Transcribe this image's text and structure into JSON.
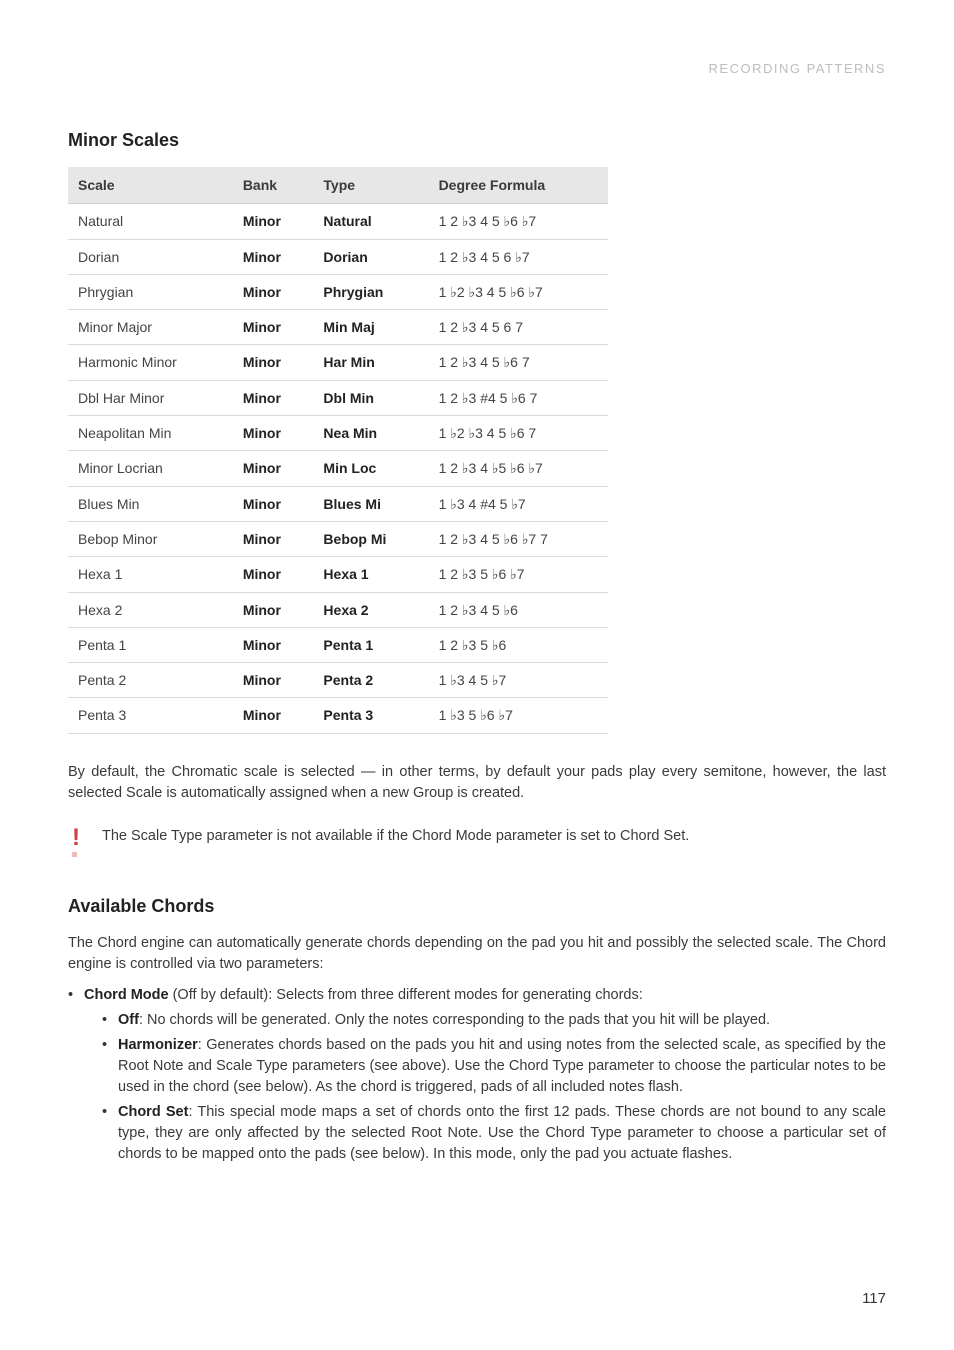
{
  "running_head": "RECORDING PATTERNS",
  "section1_title": "Minor Scales",
  "table_headers": {
    "scale": "Scale",
    "bank": "Bank",
    "type": "Type",
    "formula": "Degree Formula"
  },
  "scales": [
    {
      "name": "Natural",
      "bank": "Minor",
      "type": "Natural",
      "formula": "1 2 ♭3 4 5 ♭6 ♭7"
    },
    {
      "name": "Dorian",
      "bank": "Minor",
      "type": "Dorian",
      "formula": "1 2 ♭3 4 5 6 ♭7"
    },
    {
      "name": "Phrygian",
      "bank": "Minor",
      "type": "Phrygian",
      "formula": "1 ♭2 ♭3 4 5 ♭6 ♭7"
    },
    {
      "name": "Minor Major",
      "bank": "Minor",
      "type": "Min Maj",
      "formula": "1 2 ♭3 4 5 6 7"
    },
    {
      "name": "Harmonic Minor",
      "bank": "Minor",
      "type": "Har Min",
      "formula": "1 2 ♭3 4 5 ♭6 7"
    },
    {
      "name": "Dbl Har Minor",
      "bank": "Minor",
      "type": "Dbl Min",
      "formula": "1 2 ♭3 #4 5 ♭6 7"
    },
    {
      "name": "Neapolitan Min",
      "bank": "Minor",
      "type": "Nea Min",
      "formula": "1 ♭2 ♭3 4 5 ♭6 7"
    },
    {
      "name": "Minor Locrian",
      "bank": "Minor",
      "type": "Min Loc",
      "formula": "1 2 ♭3 4 ♭5 ♭6 ♭7"
    },
    {
      "name": "Blues Min",
      "bank": "Minor",
      "type": "Blues Mi",
      "formula": "1 ♭3 4 #4 5 ♭7"
    },
    {
      "name": "Bebop Minor",
      "bank": "Minor",
      "type": "Bebop Mi",
      "formula": "1 2 ♭3 4 5 ♭6 ♭7 7"
    },
    {
      "name": "Hexa 1",
      "bank": "Minor",
      "type": "Hexa 1",
      "formula": "1 2 ♭3 5 ♭6 ♭7"
    },
    {
      "name": "Hexa 2",
      "bank": "Minor",
      "type": "Hexa 2",
      "formula": "1 2 ♭3 4 5 ♭6"
    },
    {
      "name": "Penta 1",
      "bank": "Minor",
      "type": "Penta 1",
      "formula": "1 2 ♭3 5 ♭6"
    },
    {
      "name": "Penta 2",
      "bank": "Minor",
      "type": "Penta 2",
      "formula": "1 ♭3 4 5 ♭7"
    },
    {
      "name": "Penta 3",
      "bank": "Minor",
      "type": "Penta 3",
      "formula": "1 ♭3 5 ♭6 ♭7"
    }
  ],
  "para_default": "By default, the Chromatic scale is selected — in other terms, by default your pads play every semitone, however, the last selected Scale is automatically assigned when a new Group is created.",
  "note_text": "The Scale Type parameter is not available if the Chord Mode parameter is set to Chord Set.",
  "section2_title": "Available Chords",
  "para_chords_intro": "The Chord engine can automatically generate chords depending on the pad you hit and possibly the selected scale. The Chord engine is controlled via two parameters:",
  "chord_mode": {
    "label": "Chord Mode",
    "desc": " (Off by default): Selects from three different modes for generating chords:",
    "off_label": "Off",
    "off_desc": ": No chords will be generated. Only the notes corresponding to the pads that you hit will be played.",
    "harm_label": "Harmonizer",
    "harm_desc": ": Generates chords based on the pads you hit and using notes from the selected scale, as specified by the Root Note and Scale Type parameters (see above). Use the Chord Type parameter to choose the particular notes to be used in the chord (see below). As the chord is triggered, pads of all included notes flash.",
    "set_label": "Chord Set",
    "set_desc": ": This special mode maps a set of chords onto the first 12 pads. These chords are not bound to any scale type, they are only affected by the selected Root Note. Use the Chord Type parameter to choose a particular set of chords to be mapped onto the pads (see below). In this mode, only the pad you actuate flashes."
  },
  "page_number": "117"
}
